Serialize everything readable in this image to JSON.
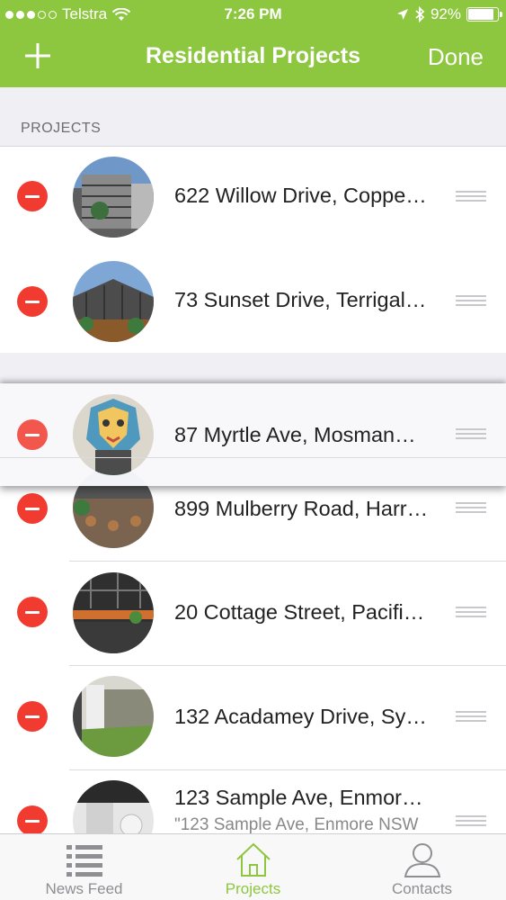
{
  "status_bar": {
    "carrier": "Telstra",
    "time": "7:26 PM",
    "battery": "92%",
    "battery_level": 0.92,
    "signal_bars": 3,
    "signal_total": 5,
    "icons": [
      "wifi-icon",
      "location-arrow-icon",
      "bluetooth-icon",
      "battery-icon"
    ]
  },
  "nav": {
    "title": "Residential Projects",
    "done_label": "Done",
    "add_icon": "plus-icon"
  },
  "section": {
    "header": "PROJECTS"
  },
  "projects": [
    {
      "address": "622 Willow Drive, Coppe…"
    },
    {
      "address": "73 Sunset Drive, Terrigal…"
    },
    {
      "address": "87 Myrtle Ave, Mosman…"
    },
    {
      "address": "899 Mulberry Road, Harr…"
    },
    {
      "address": "20 Cottage Street, Pacifi…"
    },
    {
      "address": "132 Acadamey Drive, Sy…"
    },
    {
      "address": "123 Sample Ave, Enmor…",
      "subtitle": "\"123 Sample Ave, Enmore NSW"
    }
  ],
  "tabbar": {
    "tabs": [
      {
        "label": "News Feed",
        "icon": "list-icon",
        "active": false
      },
      {
        "label": "Projects",
        "icon": "home-icon",
        "active": true
      },
      {
        "label": "Contacts",
        "icon": "person-icon",
        "active": false
      }
    ]
  },
  "colors": {
    "accent": "#8dc63f",
    "delete": "#f23b30",
    "background": "#efeff4"
  }
}
